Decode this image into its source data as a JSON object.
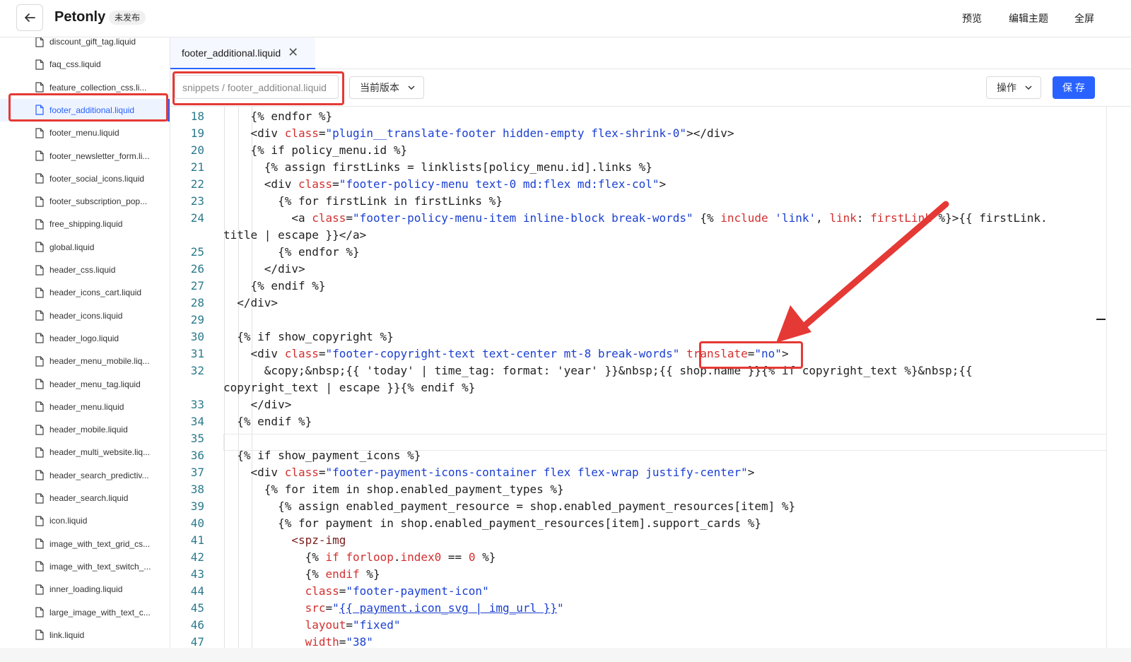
{
  "header": {
    "app_title": "Petonly",
    "status_badge": "未发布",
    "preview": "预览",
    "edit_theme": "编辑主题",
    "fullscreen": "全屏"
  },
  "sidebar": {
    "files": [
      "discount_gift_tag.liquid",
      "faq_css.liquid",
      "feature_collection_css.li...",
      "footer_additional.liquid",
      "footer_menu.liquid",
      "footer_newsletter_form.li...",
      "footer_social_icons.liquid",
      "footer_subscription_pop...",
      "free_shipping.liquid",
      "global.liquid",
      "header_css.liquid",
      "header_icons_cart.liquid",
      "header_icons.liquid",
      "header_logo.liquid",
      "header_menu_mobile.liq...",
      "header_menu_tag.liquid",
      "header_menu.liquid",
      "header_mobile.liquid",
      "header_multi_website.liq...",
      "header_search_predictiv...",
      "header_search.liquid",
      "icon.liquid",
      "image_with_text_grid_cs...",
      "image_with_text_switch_...",
      "inner_loading.liquid",
      "large_image_with_text_c...",
      "link.liquid"
    ],
    "active_index": 3
  },
  "tab": {
    "label": "footer_additional.liquid",
    "close": "✕"
  },
  "toolbar": {
    "path": "snippets / footer_additional.liquid",
    "version_select": "当前版本",
    "actions_select": "操作",
    "save": "保 存"
  },
  "editor": {
    "line_numbers": [
      "18",
      "19",
      "20",
      "21",
      "22",
      "23",
      "24",
      "25",
      "26",
      "27",
      "28",
      "29",
      "30",
      "31",
      "32",
      "33",
      "34",
      "35",
      "36",
      "37",
      "38",
      "39",
      "40",
      "41",
      "42",
      "43",
      "44",
      "45",
      "46",
      "47"
    ]
  }
}
